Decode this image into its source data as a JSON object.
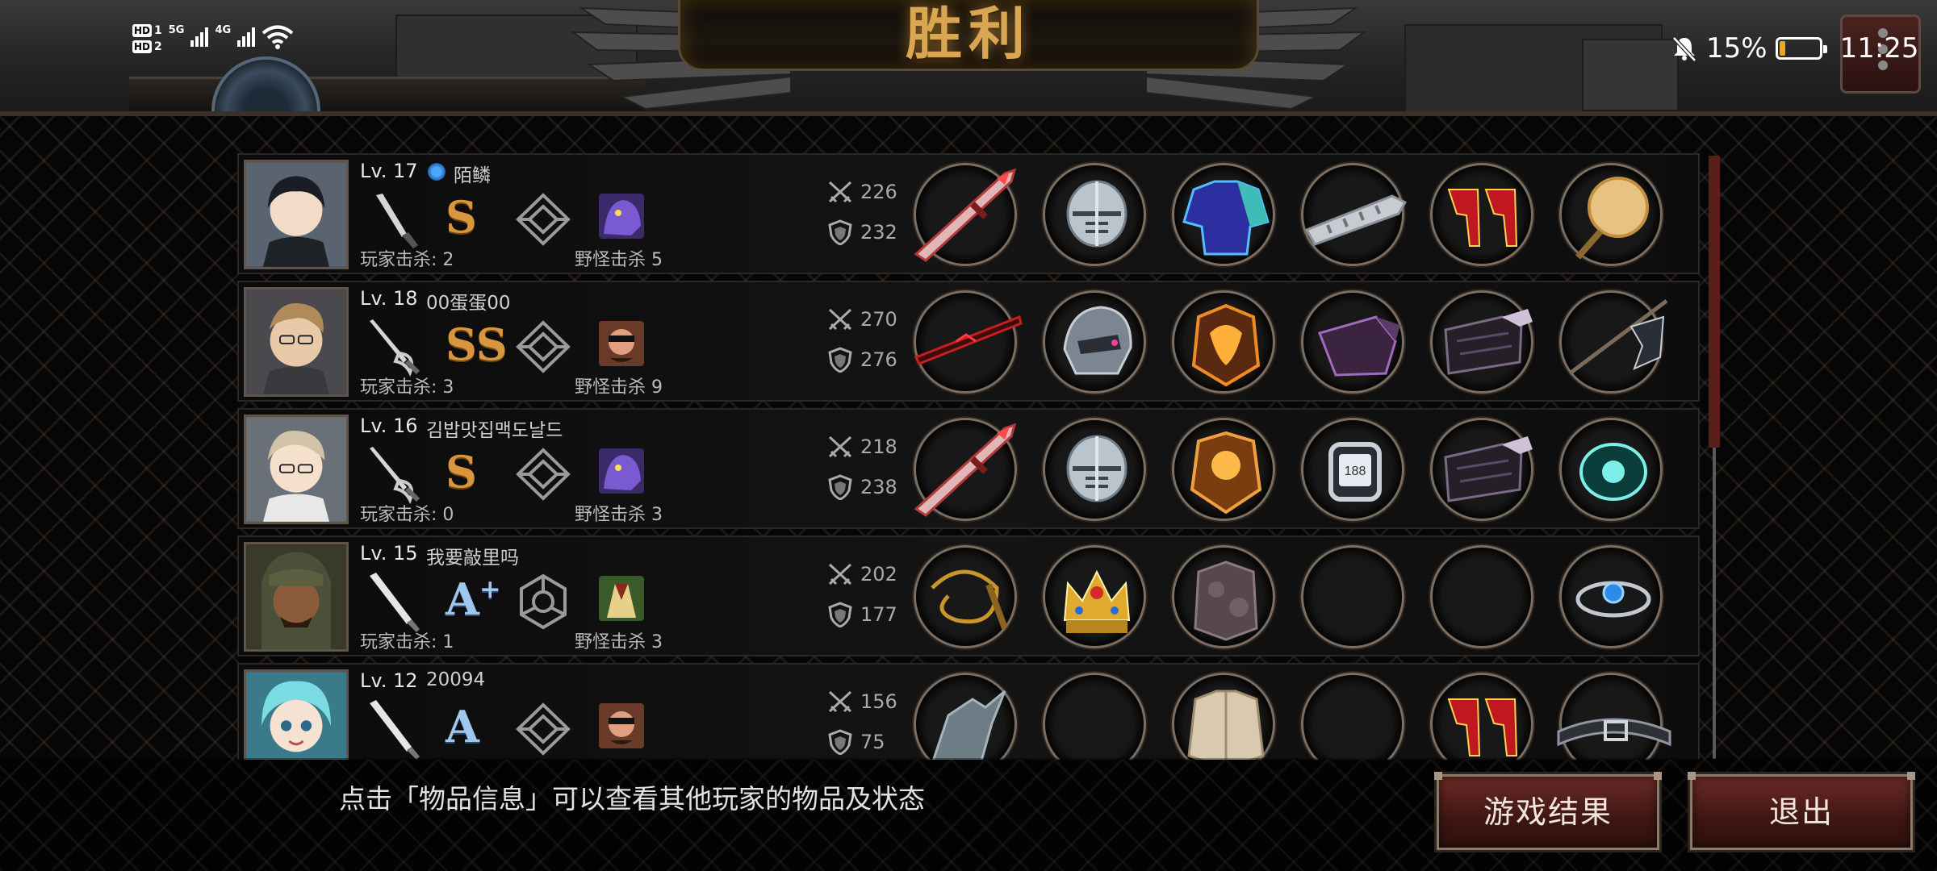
{
  "title": "胜利",
  "status_bar": {
    "sim1": "HD",
    "sim1_num": "1",
    "sim1_net": "5G",
    "sim2": "HD",
    "sim2_num": "2",
    "sim2_net": "4G",
    "battery_percent": "15%",
    "battery_level": 0.15,
    "time": "11:25",
    "icons": [
      "mute-bell-icon",
      "wifi-icon",
      "signal-icon"
    ]
  },
  "players": [
    {
      "level": "Lv. 17",
      "name": "陌鳞",
      "has_badge": true,
      "weapon": "knife-icon",
      "grade": "S",
      "grade_sup": "",
      "player_kills": "玩家击杀: 2",
      "monster_kills": "野怪击杀 5",
      "attack": "226",
      "defense": "232",
      "items": [
        "crimson-sword-icon",
        "knight-helmet-icon",
        "blue-armor-icon",
        "silver-gauntlet-icon",
        "red-heels-icon",
        "golden-mirror-icon"
      ]
    },
    {
      "level": "Lv. 18",
      "name": "00蛋蛋00",
      "has_badge": false,
      "weapon": "rapier-icon",
      "grade": "SS",
      "grade_sup": "",
      "player_kills": "玩家击杀: 3",
      "monster_kills": "野怪击杀 9",
      "attack": "270",
      "defense": "276",
      "items": [
        "dark-blade-icon",
        "mech-helmet-icon",
        "flame-armor-icon",
        "dark-gauntlet-icon",
        "shadow-boots-icon",
        "flag-icon"
      ]
    },
    {
      "level": "Lv. 16",
      "name": "김밥맛집맥도날드",
      "has_badge": false,
      "weapon": "rapier-icon",
      "grade": "S",
      "grade_sup": "",
      "player_kills": "玩家击杀: 0",
      "monster_kills": "野怪击杀 3",
      "attack": "218",
      "defense": "238",
      "items": [
        "crimson-sword-icon",
        "knight-helmet-icon",
        "gold-armor-icon",
        "watch-icon",
        "shadow-boots-icon",
        "teal-eye-icon"
      ]
    },
    {
      "level": "Lv. 15",
      "name": "我要敲里吗",
      "has_badge": false,
      "weapon": "bat-icon",
      "grade": "A",
      "grade_sup": "+",
      "player_kills": "玩家击杀: 1",
      "monster_kills": "野怪击杀 3",
      "attack": "202",
      "defense": "177",
      "items": [
        "whip-icon",
        "crown-icon",
        "stone-armor-icon",
        "empty-slot",
        "empty-slot",
        "blue-gem-bracelet-icon"
      ]
    },
    {
      "level": "Lv. 12",
      "name": "20094",
      "has_badge": false,
      "weapon": "bat-icon",
      "grade": "A",
      "grade_sup": "",
      "player_kills": "",
      "monster_kills": "",
      "attack": "156",
      "defense": "75",
      "items": [
        "statue-icon",
        "empty-slot",
        "beige-jacket-icon",
        "empty-slot",
        "red-heels-icon",
        "belt-icon"
      ]
    }
  ],
  "footer": {
    "hint": "点击「物品信息」可以查看其他玩家的物品及状态",
    "result_button": "游戏结果",
    "exit_button": "退出"
  },
  "colors": {
    "accent": "#d9963e",
    "button": "#5a221d",
    "title": "#d9a652"
  }
}
